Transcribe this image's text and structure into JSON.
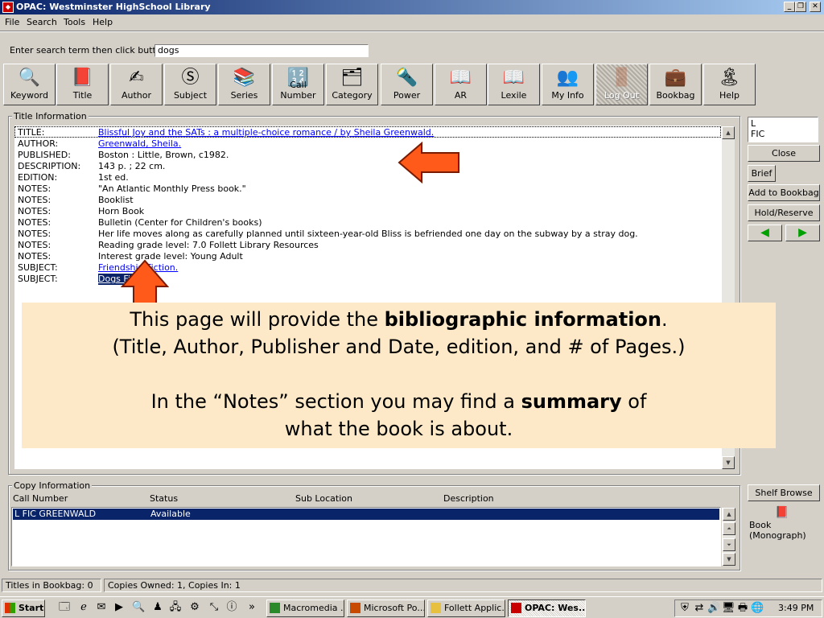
{
  "window": {
    "title": "OPAC: Westminster HighSchool Library"
  },
  "menu": [
    "File",
    "Search",
    "Tools",
    "Help"
  ],
  "search": {
    "label": "Enter search term then click button:",
    "value": "dogs"
  },
  "toolbar": [
    "Keyword",
    "Title",
    "Author",
    "Subject",
    "Series",
    "Call Number",
    "Category",
    "Power",
    "AR",
    "Lexile",
    "My Info",
    "Log Out",
    "Bookbag",
    "Help"
  ],
  "title_info": {
    "label": "Title Information",
    "rows": [
      {
        "key": "TITLE:",
        "value": "Blissful Joy and the SATs : a multiple-choice romance / by Sheila Greenwald."
      },
      {
        "key": "AUTHOR:",
        "value": "Greenwald, Sheila."
      },
      {
        "key": "PUBLISHED:",
        "value": "Boston : Little, Brown, c1982."
      },
      {
        "key": "DESCRIPTION:",
        "value": "143 p. ; 22 cm."
      },
      {
        "key": "EDITION:",
        "value": "1st ed."
      },
      {
        "key": "NOTES:",
        "value": "\"An Atlantic Monthly Press book.\""
      },
      {
        "key": "NOTES:",
        "value": "Booklist"
      },
      {
        "key": "NOTES:",
        "value": "Horn Book"
      },
      {
        "key": "NOTES:",
        "value": "Bulletin (Center for Children's books)"
      },
      {
        "key": "NOTES:",
        "value": "Her life moves along as carefully planned until sixteen-year-old Bliss is befriended one day on the subway by a stray dog."
      },
      {
        "key": "NOTES:",
        "value": "Reading grade level: 7.0 Follett Library Resources"
      },
      {
        "key": "NOTES:",
        "value": "Interest grade level: Young Adult"
      },
      {
        "key": "SUBJECT:",
        "value": "Friendship Fiction."
      },
      {
        "key": "SUBJECT:",
        "value": "Dogs Fiction."
      }
    ]
  },
  "callout": {
    "line1_pre": "This page will provide the ",
    "line1_bold": "bibliographic information",
    "line1_post": ".",
    "line2": "(Title, Author, Publisher and Date, edition, and # of Pages.)",
    "line3_pre": "In the “Notes” section you may find a ",
    "line3_bold": "summary",
    "line3_post": " of",
    "line4": "what the book is about."
  },
  "side": {
    "call_line1": "L",
    "call_line2": "FIC",
    "close": "Close",
    "brief": "Brief",
    "add_bookbag": "Add to Bookbag",
    "hold_reserve": "Hold/Reserve",
    "shelf_browse": "Shelf Browse",
    "format_line1": "Book",
    "format_line2": "(Monograph)"
  },
  "copy_info": {
    "label": "Copy Information",
    "headers": [
      "Call Number",
      "Status",
      "Sub Location",
      "Description"
    ],
    "rows": [
      {
        "call": "L FIC GREENWALD",
        "status": "Available"
      }
    ]
  },
  "status": {
    "bookbag": "Titles in Bookbag:  0",
    "copies": "Copies Owned:  1, Copies In:  1"
  },
  "taskbar": {
    "start": "Start",
    "tasks": [
      "Macromedia ...",
      "Microsoft Po...",
      "Follett Applic...",
      "OPAC: Wes..."
    ],
    "clock": "3:49 PM"
  },
  "colors": {
    "titlebar": "#0a246a",
    "callout_bg": "#fde9c8",
    "arrow": "#ff4400",
    "selection": "#0a246a"
  }
}
